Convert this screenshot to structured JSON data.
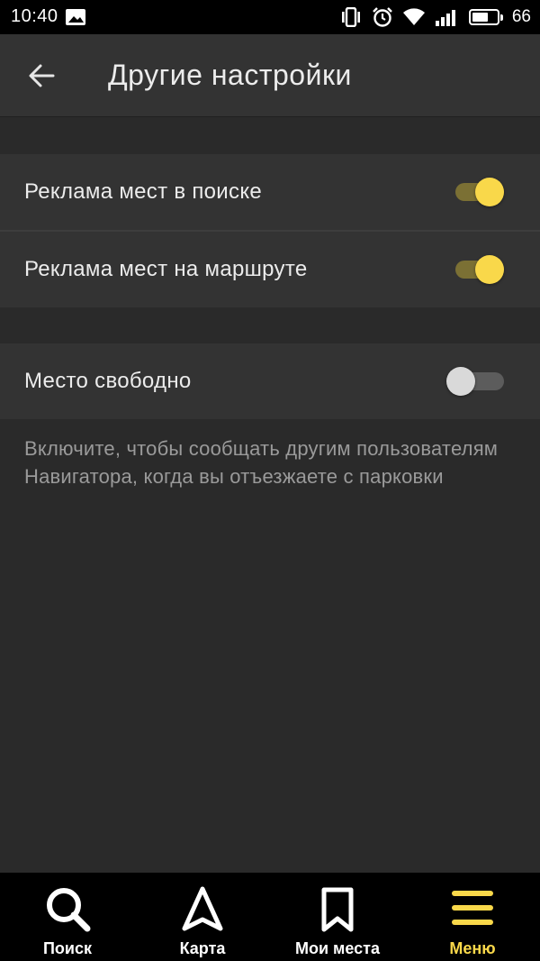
{
  "status_bar": {
    "time": "10:40",
    "battery_percent": "66",
    "battery_level": 0.66
  },
  "app_bar": {
    "title": "Другие настройки"
  },
  "settings": [
    {
      "label": "Реклама мест в поиске",
      "enabled": true
    },
    {
      "label": "Реклама мест на маршруте",
      "enabled": true
    },
    {
      "label": "Место свободно",
      "enabled": false
    }
  ],
  "hint": "Включите, чтобы сообщать другим пользователям Навигатора, когда вы отъезжаете с парковки",
  "bottom_nav": {
    "items": [
      {
        "label": "Поиск",
        "icon": "search-icon",
        "active": false
      },
      {
        "label": "Карта",
        "icon": "navigation-arrow-icon",
        "active": false
      },
      {
        "label": "Мои места",
        "icon": "bookmark-icon",
        "active": false
      },
      {
        "label": "Меню",
        "icon": "menu-icon",
        "active": true
      }
    ]
  },
  "colors": {
    "accent": "#f9d84a",
    "background": "#2a2a2a",
    "surface": "#333333"
  }
}
